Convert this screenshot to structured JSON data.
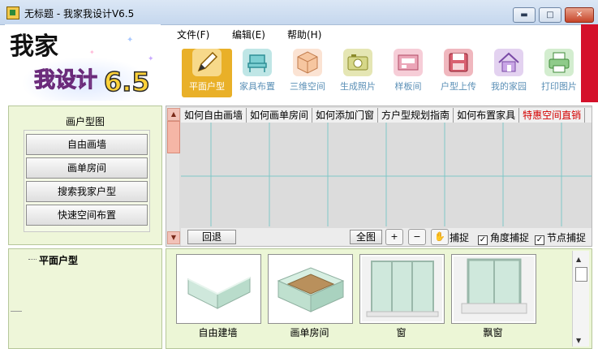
{
  "window": {
    "title": "无标题 - 我家我设计V6.5",
    "minimize_glyph": "▬",
    "maximize_glyph": "□",
    "close_glyph": "✕"
  },
  "logo": {
    "line1": "我家",
    "line2": "我设计",
    "version": "6.5"
  },
  "menu": [
    {
      "label": "文件(F)"
    },
    {
      "label": "编辑(E)"
    },
    {
      "label": "帮助(H)"
    }
  ],
  "toolbar": [
    {
      "label": "平面户型",
      "icon": "pencil-icon",
      "color": "#e9b028",
      "active": true
    },
    {
      "label": "家具布置",
      "icon": "chair-icon",
      "color": "#4fb2b8",
      "active": false
    },
    {
      "label": "三维空间",
      "icon": "cube-icon",
      "color": "#f3c4a4",
      "active": false
    },
    {
      "label": "生成照片",
      "icon": "camera-icon",
      "color": "#cfd08a",
      "active": false
    },
    {
      "label": "样板间",
      "icon": "sample-room-icon",
      "color": "#e69fb1",
      "active": false
    },
    {
      "label": "户型上传",
      "icon": "floppy-disk-icon",
      "color": "#d86070",
      "active": false
    },
    {
      "label": "我的家园",
      "icon": "house-icon",
      "color": "#b58fd3",
      "active": false
    },
    {
      "label": "打印图片",
      "icon": "printer-icon",
      "color": "#8fcb8a",
      "active": false
    }
  ],
  "left_panel": {
    "title": "画户型图",
    "buttons": [
      {
        "label": "自由画墙"
      },
      {
        "label": "画单房间"
      },
      {
        "label": "搜索我家户型"
      },
      {
        "label": "快速空间布置"
      }
    ]
  },
  "tree": {
    "root": "平面户型"
  },
  "help_links": [
    {
      "label": "如何自由画墙",
      "hot": false
    },
    {
      "label": "如何画单房间",
      "hot": false
    },
    {
      "label": "如何添加门窗",
      "hot": false
    },
    {
      "label": "方户型规划指南",
      "hot": false
    },
    {
      "label": "如何布置家具",
      "hot": false
    },
    {
      "label": "特惠空间直销",
      "hot": true
    }
  ],
  "canvas_controls": {
    "undo": "回退",
    "fit_all": "全图",
    "zoom_in_glyph": "+",
    "zoom_out_glyph": "−",
    "pan_glyph": "✋",
    "snaps": [
      {
        "label": "捕捉",
        "checked": null
      },
      {
        "label": "角度捕捉",
        "checked": true
      },
      {
        "label": "节点捕捉",
        "checked": true
      }
    ]
  },
  "palette": [
    {
      "label": "自由建墙",
      "icon": "free-wall-icon"
    },
    {
      "label": "画单房间",
      "icon": "single-room-icon"
    },
    {
      "label": "窗",
      "icon": "window-icon"
    },
    {
      "label": "飘窗",
      "icon": "bay-window-icon"
    }
  ],
  "scroll_glyphs": {
    "up": "▲",
    "down": "▼"
  },
  "colors": {
    "accent_active": "#e9b028",
    "panel_green": "#eef6d9",
    "hot_link": "#d40000",
    "toolbar_label": "#5a8fb6"
  }
}
